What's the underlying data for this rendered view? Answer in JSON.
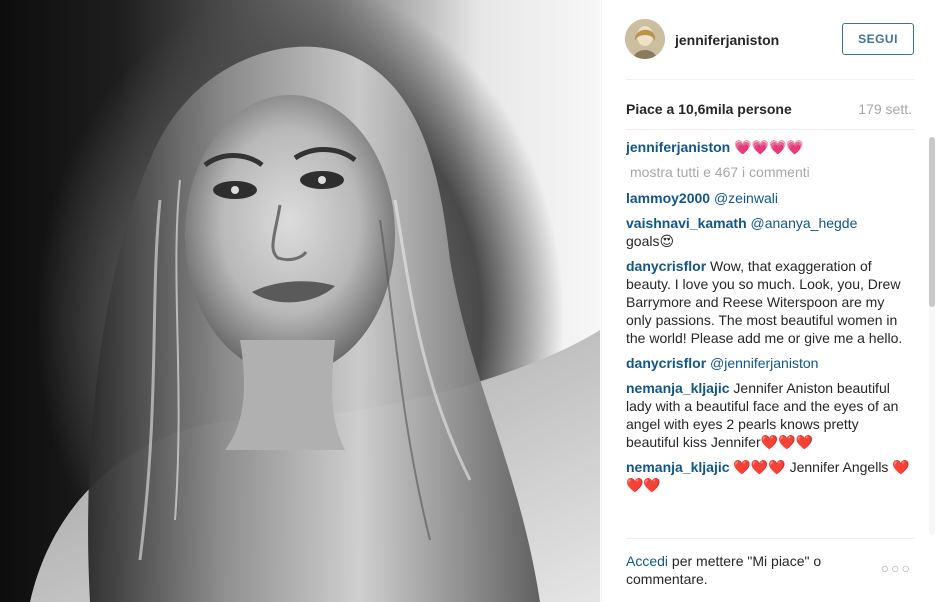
{
  "photo": {
    "description_icon": "portrait-photo"
  },
  "header": {
    "username": "jenniferjaniston",
    "follow_label": "SEGUI"
  },
  "stats": {
    "likes": "Piace a 10,6mila persone",
    "age": "179 sett."
  },
  "comments": {
    "caption_user": "jenniferjaniston",
    "caption_emojis": "💗💗💗💗",
    "view_all": "mostra tutti e 467 i commenti",
    "items": [
      {
        "user": "lammoy2000",
        "mention": "@zeinwali",
        "text": ""
      },
      {
        "user": "vaishnavi_kamath",
        "mention": "@ananya_hegde",
        "text": "goals😍"
      },
      {
        "user": "danycrisflor",
        "mention": "",
        "text": "Wow, that exaggeration of beauty. I love you so much. Look, you, Drew Barrymore and Reese Witerspoon are my only passions. The most beautiful women in the world! Please add me or give me a hello."
      },
      {
        "user": "danycrisflor",
        "mention": "@jenniferjaniston",
        "text": ""
      },
      {
        "user": "nemanja_kljajic",
        "mention": "",
        "text": "Jennifer Aniston beautiful lady with a beautiful face and the eyes of an angel with eyes 2 pearls knows pretty beautiful kiss Jennifer❤️❤️❤️"
      },
      {
        "user": "nemanja_kljajic",
        "mention": "",
        "text": "❤️❤️❤️ Jennifer Angells ❤️❤️❤️"
      }
    ]
  },
  "footer": {
    "login_link": "Accedi",
    "login_text": " per mettere \"Mi piace\" o commentare.",
    "more_label": "○○○"
  },
  "colors": {
    "link": "#125688",
    "follow": "#3f729b",
    "muted": "#a5a7aa"
  }
}
